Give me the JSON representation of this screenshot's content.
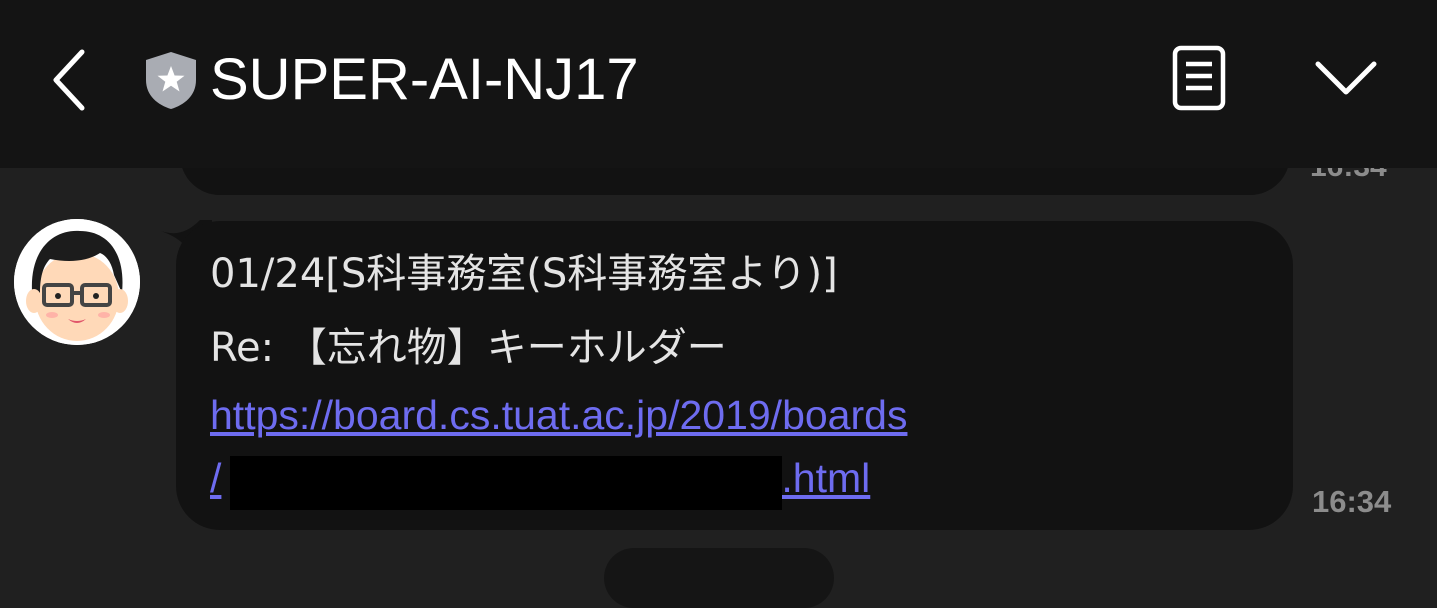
{
  "header": {
    "title": "SUPER-AI-NJ17",
    "back_icon": "chevron-left-icon",
    "verified_icon": "shield-star-icon",
    "menu_icon": "document-list-icon",
    "expand_icon": "chevron-down-icon"
  },
  "previous_message": {
    "time": "16:34"
  },
  "message": {
    "line1": "01/24[S科事務室(S科事務室より)]",
    "line2": "Re: 【忘れ物】キーホルダー",
    "link_line1": "https://board.cs.tuat.ac.jp/2019/boards",
    "link_line2_prefix": "/",
    "link_line2_suffix": ".html",
    "time": "16:34"
  },
  "colors": {
    "background": "#202020",
    "header": "#141414",
    "bubble": "#121212",
    "link": "#6e6cf0",
    "timestamp": "#8c8c8c"
  }
}
